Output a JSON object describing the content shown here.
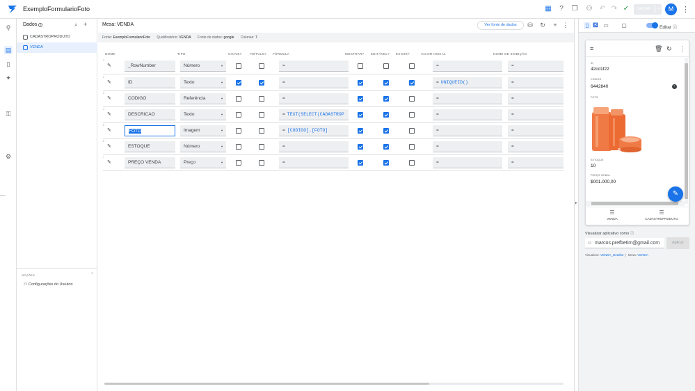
{
  "app": {
    "title": "ExemploFormularioFoto",
    "save_label": "SALVAR",
    "avatar_initial": "M"
  },
  "data_panel": {
    "title": "Dados",
    "tables": [
      {
        "name": "CADASTROPRODUTO",
        "active": false
      },
      {
        "name": "VENDA",
        "active": true
      }
    ],
    "options_label": "OPÇÕES",
    "user_settings": "Configurações do Usuário"
  },
  "main": {
    "title": "Mesa: VENDA",
    "view_source_button": "Ver fonte de dados",
    "info": {
      "source_label": "Fonte:",
      "source_value": "ExemploFormularioFoto",
      "qualifier_label": "Qualificatório:",
      "qualifier_value": "VENDA",
      "datasource_label": "Fonte de dados:",
      "datasource_value": "google",
      "columns_label": "Colunas:",
      "columns_value": "7"
    },
    "headers": {
      "name": "NOME",
      "type": "TIPO",
      "key": "CHAVE?",
      "label": "RÓTULO?",
      "formula": "FÓRMULA",
      "show": "MOSTRAR?",
      "editable": "EDITÁVEL?",
      "require": "EXIGIR?",
      "initial": "VALOR INICIAL",
      "display": "NOME DE EXIBIÇÃO"
    },
    "rows": [
      {
        "num": "1",
        "name": "_RowNumber",
        "type": "Número",
        "key": false,
        "label": false,
        "formula": "",
        "show": false,
        "editable": false,
        "require": false,
        "initial": ""
      },
      {
        "num": "2",
        "name": "ID",
        "type": "Texto",
        "key": true,
        "label": true,
        "formula": "",
        "show": true,
        "editable": true,
        "require": true,
        "initial": "UNIQUEID()"
      },
      {
        "num": "3",
        "name": "CODIGO",
        "type": "Referência",
        "key": false,
        "label": false,
        "formula": "",
        "show": true,
        "editable": true,
        "require": false,
        "initial": ""
      },
      {
        "num": "4",
        "name": "DESCRICAO",
        "type": "Texto",
        "key": false,
        "label": false,
        "formula": "TEXT(SELECT(CADASTROP",
        "show": true,
        "editable": true,
        "require": false,
        "initial": ""
      },
      {
        "num": "5",
        "name": "FOTO",
        "type": "Imagem",
        "key": false,
        "label": false,
        "formula": "[CODIGO].[FOTO]",
        "show": true,
        "editable": true,
        "require": false,
        "initial": ""
      },
      {
        "num": "6",
        "name": "ESTOQUE",
        "type": "Número",
        "key": false,
        "label": false,
        "formula": "",
        "show": true,
        "editable": true,
        "require": false,
        "initial": ""
      },
      {
        "num": "7",
        "name": "PREÇO VENDA",
        "type": "Preço",
        "key": false,
        "label": false,
        "formula": "",
        "show": true,
        "editable": true,
        "require": false,
        "initial": ""
      }
    ],
    "eq": "="
  },
  "preview": {
    "editar_label": "Editar",
    "fields": [
      {
        "label": "ID",
        "value": "42cd1f22"
      },
      {
        "label": "CODIGO",
        "value": "6442840"
      },
      {
        "label": "FOTO",
        "value": ""
      },
      {
        "label": "ESTOQUE",
        "value": "10"
      },
      {
        "label": "PREÇO VENDA",
        "value": "$001.000,00"
      }
    ],
    "tabs": [
      "VENDA",
      "CADASTROPRODUTO"
    ],
    "view_as_label": "Visualizar aplicativo como",
    "email": "marcos.prefbetim@gmail.com",
    "apply_label": "Aplicar",
    "footer": {
      "view_label": "Visualizar:",
      "view_value": "VENDA_Detalhe",
      "sep": "|",
      "table_label": "Mesa:",
      "table_value": "VENDA"
    }
  },
  "colors": {
    "accent": "#1a73e8",
    "product": "#f07a45"
  }
}
